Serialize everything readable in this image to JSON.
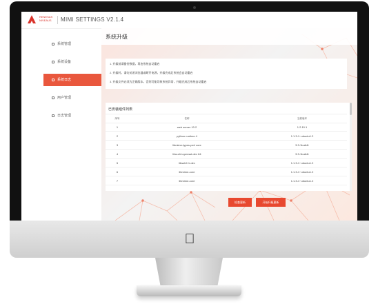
{
  "app": {
    "brand_top": "RENESAS",
    "brand_bottom": "NIVEAUS",
    "title": "MIMI SETTINGS  V2.1.4"
  },
  "sidebar": {
    "items": [
      {
        "label": "系统管理",
        "active": false
      },
      {
        "label": "系统设备",
        "active": false
      },
      {
        "label": "系统日志",
        "active": true
      },
      {
        "label": "用户管理",
        "active": false
      },
      {
        "label": "日志管理",
        "active": false
      }
    ]
  },
  "page": {
    "title": "系统升级"
  },
  "notice": {
    "lines": [
      "1. 升级前请备份数据，再由系统自动重启",
      "2. 升级时，请勿关闭浏览器或断开电源，升级完成后系统会自动重启",
      "3. 升级文件必须为正确版本，否则可能导致系统异常，升级完成后系统自动重启"
    ]
  },
  "table": {
    "title": "已安装组件列表",
    "headers": [
      "序号",
      "名称",
      "当前版本"
    ],
    "rows": [
      {
        "index": "1",
        "name": "web server 10.2",
        "version": "1.2.10.1"
      },
      {
        "index": "2",
        "name": "python runtime 4",
        "version": "1.1.3-1~ubuntu1.2"
      },
      {
        "index": "3",
        "name": "libmime-types-perl core",
        "version": "3.3-1build1"
      },
      {
        "index": "4",
        "name": "libcurl4-openssl-dev 64",
        "version": "3.3-1build1"
      },
      {
        "index": "5",
        "name": "libssh2-1-dev",
        "version": "1.1.3-1~ubuntu1.2"
      },
      {
        "index": "6",
        "name": "libmime-core",
        "version": "1.1.3-1~ubuntu1.2"
      },
      {
        "index": "7",
        "name": "libmime-core",
        "version": "1.1.3-1~ubuntu1.2"
      }
    ]
  },
  "actions": {
    "primary": "检查更新",
    "secondary": "开始升级更新"
  },
  "colors": {
    "accent": "#e8482f",
    "active": "#e9573d",
    "brand": "#d9332b"
  },
  "icons": {
    "brand": "renesas-logo-icon",
    "hardware_logo": "apple-logo-icon"
  }
}
